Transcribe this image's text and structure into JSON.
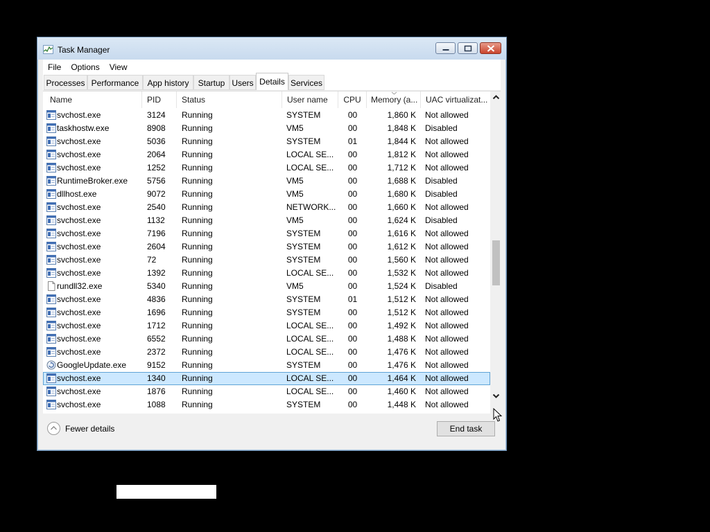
{
  "window": {
    "title": "Task Manager"
  },
  "menu": [
    "File",
    "Options",
    "View"
  ],
  "tabs": [
    "Processes",
    "Performance",
    "App history",
    "Startup",
    "Users",
    "Details",
    "Services"
  ],
  "active_tab": "Details",
  "columns": {
    "name": "Name",
    "pid": "PID",
    "status": "Status",
    "user": "User name",
    "cpu": "CPU",
    "memory": "Memory (a...",
    "uac": "UAC virtualizat..."
  },
  "rows": [
    {
      "name": "svchost.exe",
      "pid": "3124",
      "status": "Running",
      "user": "SYSTEM",
      "cpu": "00",
      "memory": "1,860 K",
      "uac": "Not allowed",
      "icon": "service-icon"
    },
    {
      "name": "taskhostw.exe",
      "pid": "8908",
      "status": "Running",
      "user": "VM5",
      "cpu": "00",
      "memory": "1,848 K",
      "uac": "Disabled",
      "icon": "service-icon"
    },
    {
      "name": "svchost.exe",
      "pid": "5036",
      "status": "Running",
      "user": "SYSTEM",
      "cpu": "01",
      "memory": "1,844 K",
      "uac": "Not allowed",
      "icon": "service-icon"
    },
    {
      "name": "svchost.exe",
      "pid": "2064",
      "status": "Running",
      "user": "LOCAL SE...",
      "cpu": "00",
      "memory": "1,812 K",
      "uac": "Not allowed",
      "icon": "service-icon"
    },
    {
      "name": "svchost.exe",
      "pid": "1252",
      "status": "Running",
      "user": "LOCAL SE...",
      "cpu": "00",
      "memory": "1,712 K",
      "uac": "Not allowed",
      "icon": "service-icon"
    },
    {
      "name": "RuntimeBroker.exe",
      "pid": "5756",
      "status": "Running",
      "user": "VM5",
      "cpu": "00",
      "memory": "1,688 K",
      "uac": "Disabled",
      "icon": "service-icon"
    },
    {
      "name": "dllhost.exe",
      "pid": "9072",
      "status": "Running",
      "user": "VM5",
      "cpu": "00",
      "memory": "1,680 K",
      "uac": "Disabled",
      "icon": "service-icon"
    },
    {
      "name": "svchost.exe",
      "pid": "2540",
      "status": "Running",
      "user": "NETWORK...",
      "cpu": "00",
      "memory": "1,660 K",
      "uac": "Not allowed",
      "icon": "service-icon"
    },
    {
      "name": "svchost.exe",
      "pid": "1132",
      "status": "Running",
      "user": "VM5",
      "cpu": "00",
      "memory": "1,624 K",
      "uac": "Disabled",
      "icon": "service-icon"
    },
    {
      "name": "svchost.exe",
      "pid": "7196",
      "status": "Running",
      "user": "SYSTEM",
      "cpu": "00",
      "memory": "1,616 K",
      "uac": "Not allowed",
      "icon": "service-icon"
    },
    {
      "name": "svchost.exe",
      "pid": "2604",
      "status": "Running",
      "user": "SYSTEM",
      "cpu": "00",
      "memory": "1,612 K",
      "uac": "Not allowed",
      "icon": "service-icon"
    },
    {
      "name": "svchost.exe",
      "pid": "72",
      "status": "Running",
      "user": "SYSTEM",
      "cpu": "00",
      "memory": "1,560 K",
      "uac": "Not allowed",
      "icon": "service-icon"
    },
    {
      "name": "svchost.exe",
      "pid": "1392",
      "status": "Running",
      "user": "LOCAL SE...",
      "cpu": "00",
      "memory": "1,532 K",
      "uac": "Not allowed",
      "icon": "service-icon"
    },
    {
      "name": "rundll32.exe",
      "pid": "5340",
      "status": "Running",
      "user": "VM5",
      "cpu": "00",
      "memory": "1,524 K",
      "uac": "Disabled",
      "icon": "document-icon"
    },
    {
      "name": "svchost.exe",
      "pid": "4836",
      "status": "Running",
      "user": "SYSTEM",
      "cpu": "01",
      "memory": "1,512 K",
      "uac": "Not allowed",
      "icon": "service-icon"
    },
    {
      "name": "svchost.exe",
      "pid": "1696",
      "status": "Running",
      "user": "SYSTEM",
      "cpu": "00",
      "memory": "1,512 K",
      "uac": "Not allowed",
      "icon": "service-icon"
    },
    {
      "name": "svchost.exe",
      "pid": "1712",
      "status": "Running",
      "user": "LOCAL SE...",
      "cpu": "00",
      "memory": "1,492 K",
      "uac": "Not allowed",
      "icon": "service-icon"
    },
    {
      "name": "svchost.exe",
      "pid": "6552",
      "status": "Running",
      "user": "LOCAL SE...",
      "cpu": "00",
      "memory": "1,488 K",
      "uac": "Not allowed",
      "icon": "service-icon"
    },
    {
      "name": "svchost.exe",
      "pid": "2372",
      "status": "Running",
      "user": "LOCAL SE...",
      "cpu": "00",
      "memory": "1,476 K",
      "uac": "Not allowed",
      "icon": "service-icon"
    },
    {
      "name": "GoogleUpdate.exe",
      "pid": "9152",
      "status": "Running",
      "user": "SYSTEM",
      "cpu": "00",
      "memory": "1,476 K",
      "uac": "Not allowed",
      "icon": "google-update-icon"
    },
    {
      "name": "svchost.exe",
      "pid": "1340",
      "status": "Running",
      "user": "LOCAL SE...",
      "cpu": "00",
      "memory": "1,464 K",
      "uac": "Not allowed",
      "icon": "service-icon",
      "selected": true
    },
    {
      "name": "svchost.exe",
      "pid": "1876",
      "status": "Running",
      "user": "LOCAL SE...",
      "cpu": "00",
      "memory": "1,460 K",
      "uac": "Not allowed",
      "icon": "service-icon"
    },
    {
      "name": "svchost.exe",
      "pid": "1088",
      "status": "Running",
      "user": "SYSTEM",
      "cpu": "00",
      "memory": "1,448 K",
      "uac": "Not allowed",
      "icon": "service-icon"
    }
  ],
  "footer": {
    "fewer_details": "Fewer details",
    "end_task": "End task"
  }
}
